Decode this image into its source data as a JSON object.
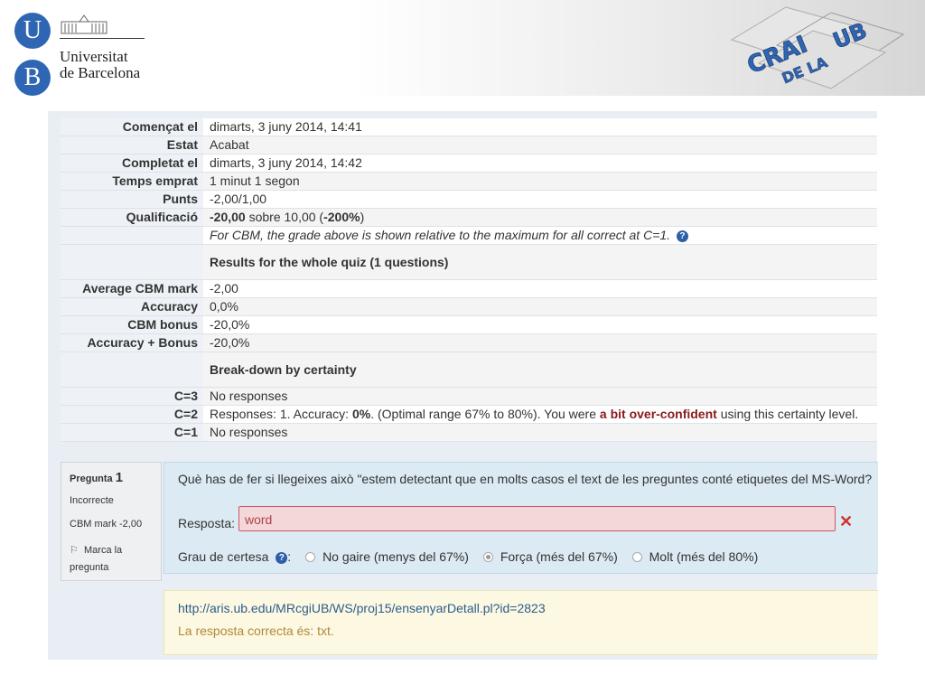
{
  "header": {
    "logo_letter_u": "U",
    "logo_letter_b": "B",
    "university_line1": "Universitat",
    "university_line2": "de Barcelona",
    "crai_logo_text": "CRAI DE LA UB"
  },
  "summary": {
    "rows": [
      {
        "label": "Començat el",
        "value": "dimarts, 3 juny 2014, 14:41"
      },
      {
        "label": "Estat",
        "value": "Acabat"
      },
      {
        "label": "Completat el",
        "value": "dimarts, 3 juny 2014, 14:42"
      },
      {
        "label": "Temps emprat",
        "value": "1 minut 1 segon"
      },
      {
        "label": "Punts",
        "value": "-2,00/1,00"
      }
    ],
    "grade_label": "Qualificació",
    "grade_bold": "-20,00",
    "grade_mid": " sobre 10,00 (",
    "grade_pct": "-200%",
    "grade_end": ")",
    "cbm_note": "For CBM, the grade above is shown relative to the maximum for all correct at C=1.",
    "results_heading": "Results for the whole quiz (1 questions)",
    "results_rows": [
      {
        "label": "Average CBM mark",
        "value": "-2,00"
      },
      {
        "label": "Accuracy",
        "value": "0,0%"
      },
      {
        "label": "CBM bonus",
        "value": "-20,0%"
      },
      {
        "label": "Accuracy + Bonus",
        "value": "-20,0%"
      }
    ],
    "breakdown_heading": "Break-down by certainty",
    "c3_label": "C=3",
    "c3_value": "No responses",
    "c2_label": "C=2",
    "c2_a": "Responses: 1. Accuracy: ",
    "c2_acc": "0%",
    "c2_b": ". (Optimal range 67% to 80%). You were ",
    "c2_conf": "a bit over-confident",
    "c2_c": " using this certainty level.",
    "c1_label": "C=1",
    "c1_value": "No responses"
  },
  "question_info": {
    "label": "Pregunta",
    "number": "1",
    "state": "Incorrecte",
    "mark": "CBM mark -2,00",
    "flag": "Marca la pregunta"
  },
  "question": {
    "text": "Què has de fer si llegeixes això \"estem detectant que en molts casos el text de les preguntes conté etiquetes del MS-Word?",
    "answer_label": "Resposta:",
    "answer_value": "word",
    "certainty_label": "Grau de certesa",
    "certainty_colon": ":",
    "options": [
      "No gaire (menys del 67%)",
      "Força (més del 67%)",
      "Molt (més del 80%)"
    ],
    "selected_option": "Força (més del 67%)"
  },
  "feedback": {
    "link": "http://aris.ub.edu/MRcgiUB/WS/proj15/ensenyarDetall.pl?id=2823",
    "right_answer": "La resposta correcta és: txt."
  },
  "colors": {
    "brand_blue": "#2f66b3",
    "incorrect_red": "#c95a66",
    "question_bg": "#dbeaf3",
    "feedback_bg": "#fcf8e1"
  }
}
